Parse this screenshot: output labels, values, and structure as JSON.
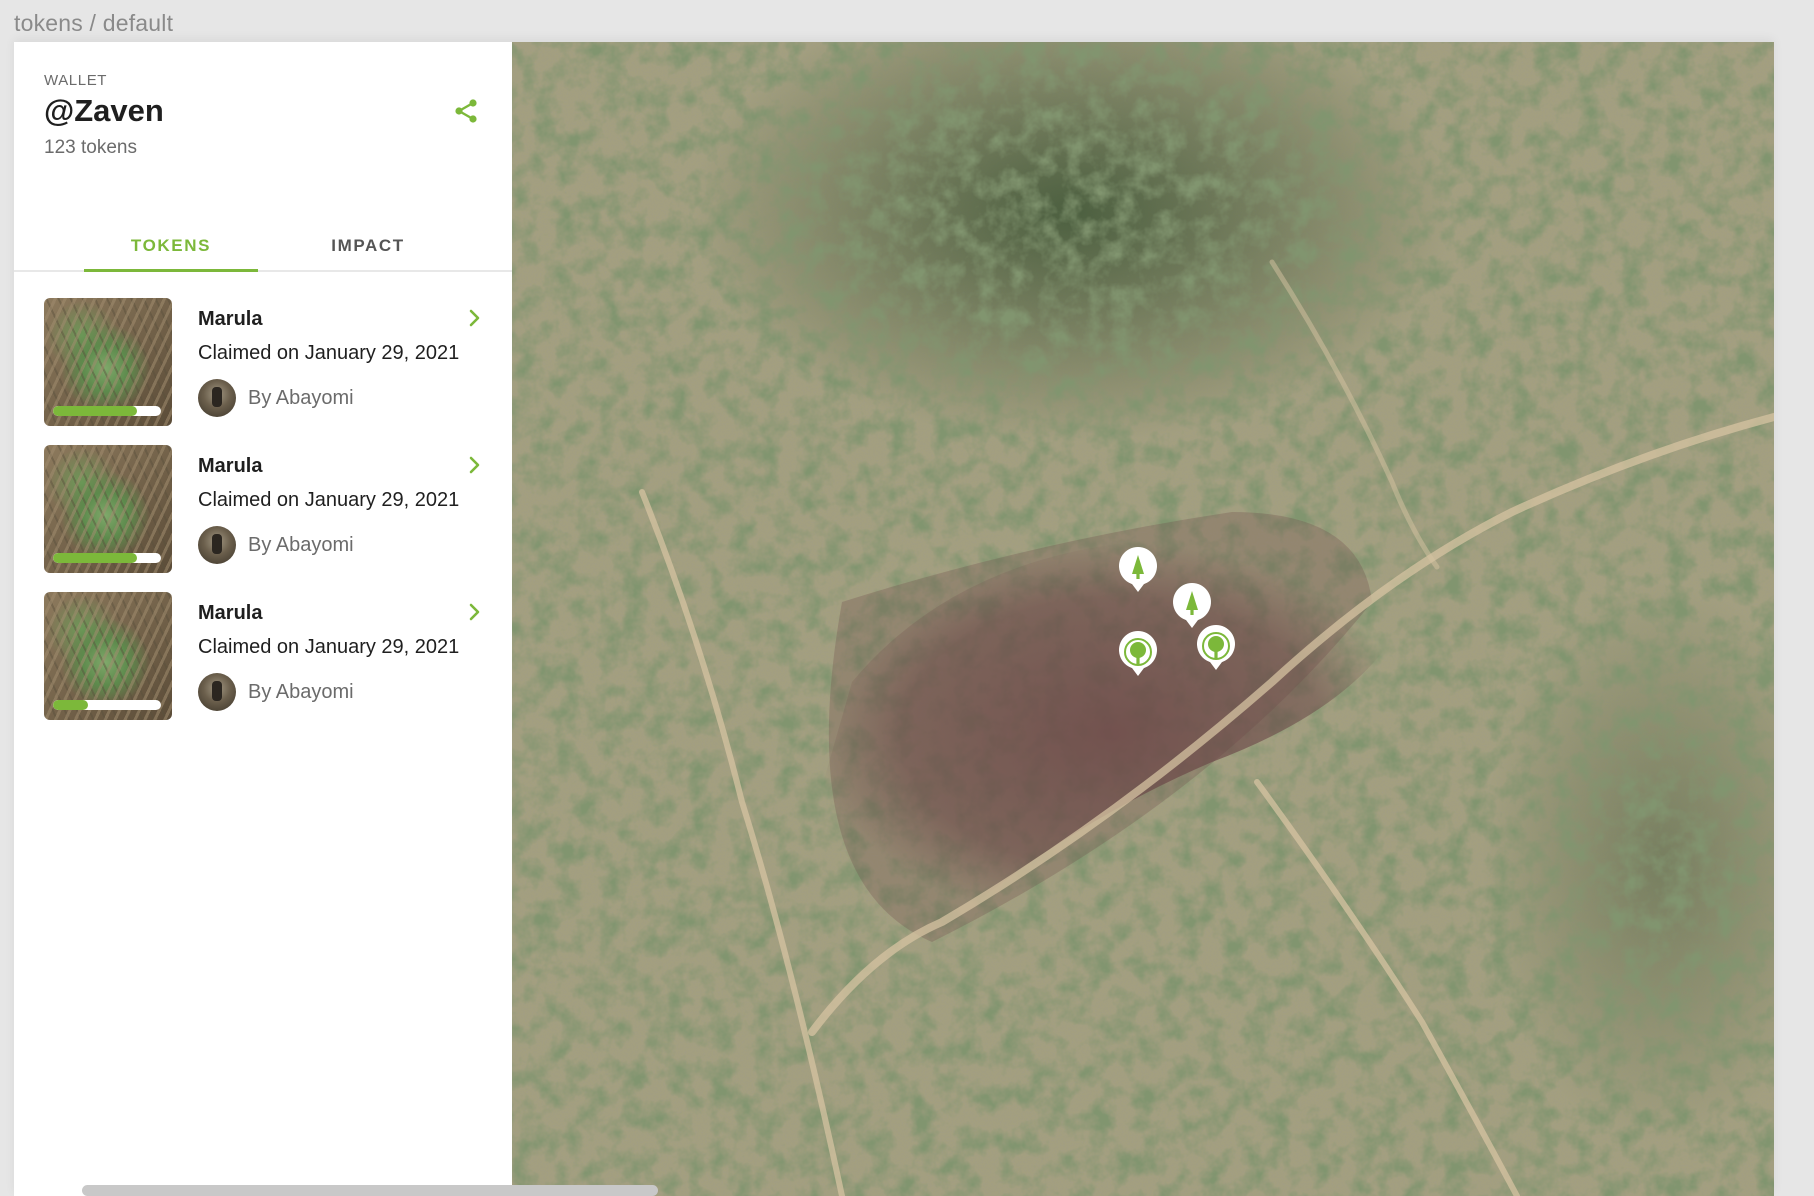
{
  "breadcrumb": "tokens / default",
  "wallet": {
    "kicker": "WALLET",
    "handle": "@Zaven",
    "token_count": "123 tokens",
    "share_icon": "share-icon"
  },
  "tabs": [
    {
      "label": "TOKENS",
      "active": true
    },
    {
      "label": "IMPACT",
      "active": false
    }
  ],
  "tokens": [
    {
      "species": "Marula",
      "claimed": "Claimed on January 29, 2021",
      "planter": "By Abayomi",
      "progress": 0.78
    },
    {
      "species": "Marula",
      "claimed": "Claimed on January 29, 2021",
      "planter": "By Abayomi",
      "progress": 0.78
    },
    {
      "species": "Marula",
      "claimed": "Claimed on January 29, 2021",
      "planter": "By Abayomi",
      "progress": 0.32
    }
  ],
  "colors": {
    "accent": "#7cb83a",
    "text_primary": "#1f1f1f",
    "text_secondary": "#6b6b6b",
    "page_bg": "#e6e6e6"
  },
  "map": {
    "type": "satellite",
    "markers": [
      {
        "icon": "conifer-tree-icon"
      },
      {
        "icon": "conifer-tree-icon"
      },
      {
        "icon": "round-tree-icon"
      },
      {
        "icon": "round-tree-icon"
      }
    ]
  }
}
